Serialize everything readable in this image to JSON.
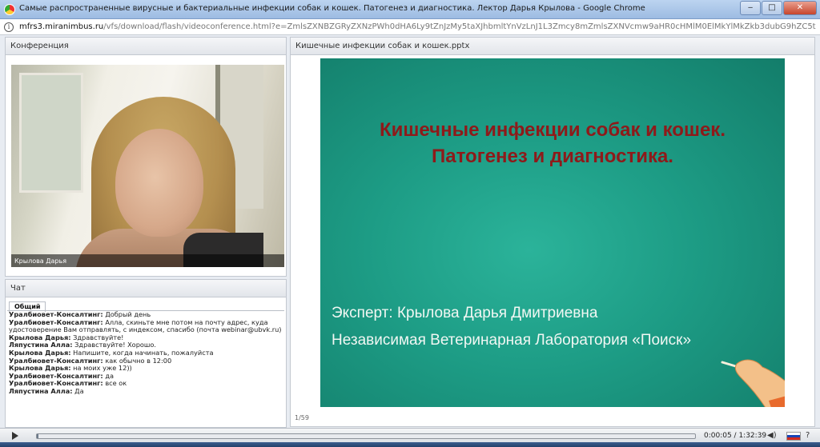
{
  "window": {
    "title": "Самые распространенные вирусные и бактериальные инфекции собак и кошек. Патогенез и диагностика. Лектор Дарья Крылова - Google Chrome",
    "minimize": "‒",
    "maximize": "□",
    "close": "✕"
  },
  "address": {
    "host": "mfrs3.miranimbus.ru",
    "path": "/vfs/download/flash/videoconference.html?e=ZmlsZXNBZGRyZXNzPWh0dHA6Ly9tZnJzMy5taXJhbmltYnVzLnJ1L3Zmcy8mZmlsZXNVcmw9aHR0cHMlM0ElMkYlMkZkb3dubG9hZC5taXJhbmltYnVzLnJ1"
  },
  "conference": {
    "header": "Конференция",
    "speaker_name": "Крылова Дарья"
  },
  "chat": {
    "header": "Чат",
    "tab": "Общий",
    "messages": [
      {
        "author": "Уралбиовет-Консалтинг:",
        "text": "Добрый день"
      },
      {
        "author": "Уралбиовет-Консалтинг:",
        "text": "Алла, скиньте мне потом на почту адрес, куда удостоверение Вам отправлять, с индексом, спасибо (почта webinar@ubvk.ru)"
      },
      {
        "author": "Крылова Дарья:",
        "text": "Здравствуйте!"
      },
      {
        "author": "Ляпустина Алла:",
        "text": "Здравствуйте! Хорошо."
      },
      {
        "author": "Крылова Дарья:",
        "text": "Напишите, когда начинать, пожалуйста"
      },
      {
        "author": "Уралбиовет-Консалтинг:",
        "text": "как обычно в 12:00"
      },
      {
        "author": "Крылова Дарья:",
        "text": "на моих уже 12))"
      },
      {
        "author": "Уралбиовет-Консалтинг:",
        "text": "да"
      },
      {
        "author": "Уралбиовет-Консалтинг:",
        "text": "все ок"
      },
      {
        "author": "Ляпустина Алла:",
        "text": "Да"
      }
    ]
  },
  "presentation": {
    "header": "Кишечные инфекции собак и кошек.pptx",
    "slide_title_line1": "Кишечные инфекции собак и кошек.",
    "slide_title_line2": "Патогенез и диагностика.",
    "slide_expert": "Эксперт: Крылова Дарья Дмитриевна",
    "slide_lab": "Независимая Ветеринарная Лаборатория «Поиск»",
    "page_count": "1/59",
    "colors": {
      "slide_bg": "#1d9c85",
      "title": "#8e1a1a"
    }
  },
  "player": {
    "time": "0:00:05 / 1:32:39",
    "progress": 0.001,
    "volume_icon": "speaker-icon",
    "language_icon": "russian-flag-icon",
    "help": "?"
  }
}
